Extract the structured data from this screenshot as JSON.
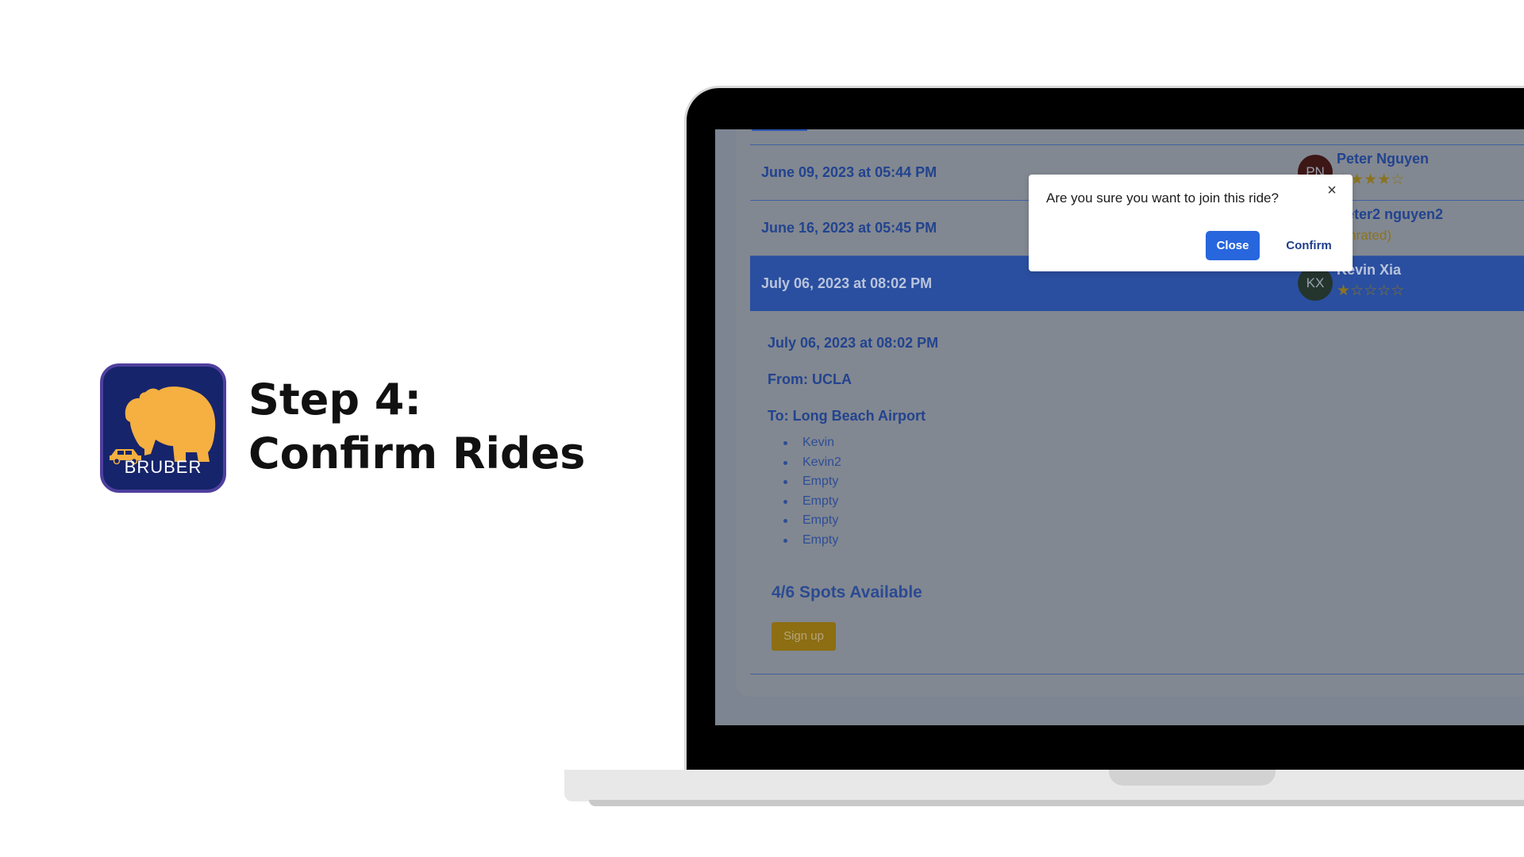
{
  "hero": {
    "logo_text": "BRUBER",
    "title_line1": "Step 4:",
    "title_line2": "Confirm Rides"
  },
  "rides": [
    {
      "date": "June 09, 2023 at 05:44 PM",
      "driver_initials": "PN",
      "driver_name": "Peter Nguyen",
      "rating_stars": "★★★★☆",
      "rating": 4
    },
    {
      "date": "June 16, 2023 at 05:45 PM",
      "driver_initials": "",
      "driver_name": "Peter2 nguyen2",
      "rating_text": "(unrated)"
    },
    {
      "date": "July 06, 2023 at 08:02 PM",
      "driver_initials": "KX",
      "driver_name": "Kevin Xia",
      "rating_stars": "★☆☆☆☆",
      "rating": 1,
      "selected": true
    }
  ],
  "detail": {
    "date": "July 06, 2023 at 08:02 PM",
    "from": "From: UCLA",
    "to": "To: Long Beach Airport",
    "passengers": [
      "Kevin",
      "Kevin2",
      "Empty",
      "Empty",
      "Empty",
      "Empty"
    ],
    "spots": "4/6 Spots Available",
    "signup_label": "Sign up"
  },
  "modal": {
    "message": "Are you sure you want to join this ride?",
    "close_icon": "×",
    "close_label": "Close",
    "confirm_label": "Confirm"
  },
  "colors": {
    "logo_bg": "#16246b",
    "logo_bear": "#f5b041",
    "primary_blue": "#2766dd",
    "selected_row": "#2a4fa0",
    "signup_gold": "#8d6e12",
    "star_gold": "#8a7420"
  }
}
